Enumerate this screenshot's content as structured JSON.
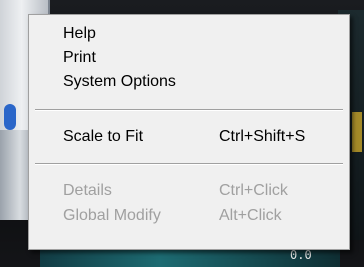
{
  "background": {
    "readout": "0.0"
  },
  "menu": {
    "items": [
      {
        "label": "Help",
        "shortcut": "",
        "enabled": true
      },
      {
        "label": "Print",
        "shortcut": "",
        "enabled": true
      },
      {
        "label": "System Options",
        "shortcut": "",
        "enabled": true
      },
      {
        "label": "Scale to Fit",
        "shortcut": "Ctrl+Shift+S",
        "enabled": true
      },
      {
        "label": "Details",
        "shortcut": "Ctrl+Click",
        "enabled": false
      },
      {
        "label": "Global Modify",
        "shortcut": "Alt+Click",
        "enabled": false
      }
    ],
    "colors": {
      "background": "#f0f0f0",
      "text": "#000000",
      "disabled_text": "#a0a0a0",
      "separator": "#a0a0a0"
    }
  }
}
